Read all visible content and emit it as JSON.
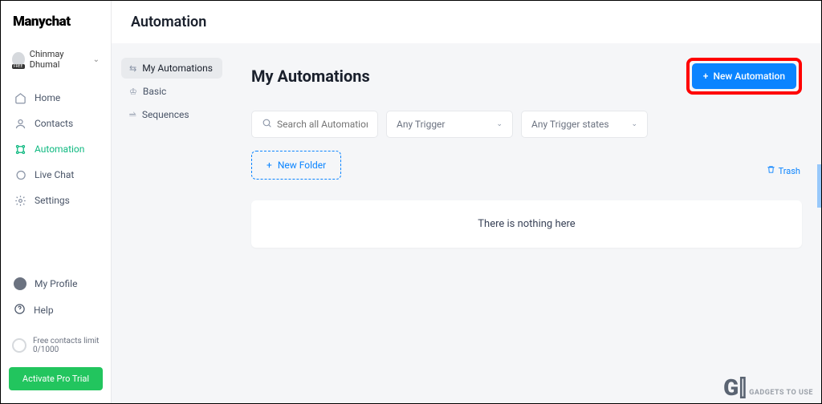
{
  "brand": "Manychat",
  "user": {
    "name": "Chinmay Dhumal",
    "badge": "FREE"
  },
  "nav": {
    "home": "Home",
    "contacts": "Contacts",
    "automation": "Automation",
    "livechat": "Live Chat",
    "settings": "Settings"
  },
  "bottom": {
    "profile": "My Profile",
    "help": "Help",
    "limit_label": "Free contacts limit",
    "limit_value": "0/1000",
    "activate": "Activate Pro Trial"
  },
  "header": {
    "title": "Automation"
  },
  "secNav": {
    "my": "My Automations",
    "basic": "Basic",
    "sequences": "Sequences"
  },
  "panel": {
    "title": "My Automations",
    "new_automation": "New Automation",
    "search_placeholder": "Search all Automations",
    "trigger_filter": "Any Trigger",
    "state_filter": "Any Trigger states",
    "new_folder": "New Folder",
    "trash": "Trash",
    "empty": "There is nothing here"
  },
  "watermark": {
    "text": "GADGETS TO USE"
  }
}
